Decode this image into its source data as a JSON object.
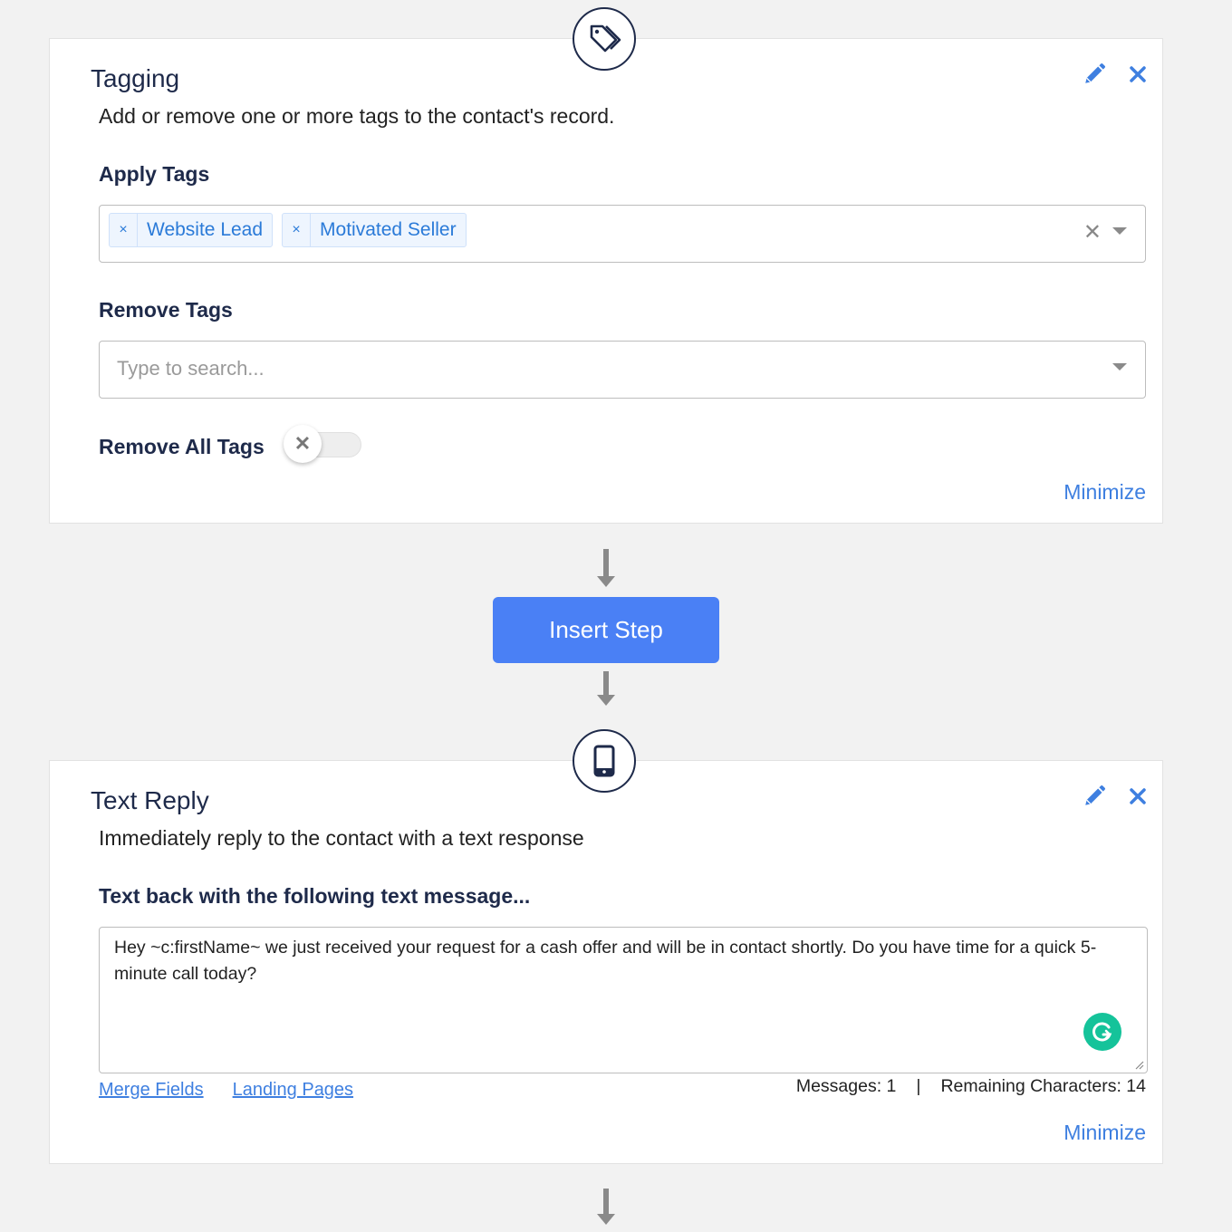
{
  "colors": {
    "background": "#f2f2f2",
    "card": "#ffffff",
    "heading": "#1e2a4a",
    "accent": "#4a80f5",
    "link": "#3e7fe0",
    "tag_bg": "#eef5fe",
    "tag_text": "#2a7ad8",
    "grammarly": "#15c39a"
  },
  "steps": [
    {
      "icon": "tags-icon",
      "title": "Tagging",
      "description": "Add or remove one or more tags to the contact's record.",
      "apply_tags": {
        "label": "Apply Tags",
        "selected": [
          "Website Lead",
          "Motivated Seller"
        ],
        "remove_tag_glyph": "×",
        "clear_glyph": "✕"
      },
      "remove_tags": {
        "label": "Remove Tags",
        "placeholder": "Type to search..."
      },
      "remove_all_tags": {
        "label": "Remove All Tags",
        "enabled": false,
        "knob_glyph": "✕"
      },
      "minimize_label": "Minimize"
    },
    {
      "icon": "mobile-phone-icon",
      "title": "Text Reply",
      "description": "Immediately reply to the contact with a text response",
      "message_label": "Text back with the following text message...",
      "message": "Hey ~c:firstName~ we just received your request for a cash offer and will be in contact shortly. Do you have time for a quick 5-minute call today?",
      "links": [
        "Merge Fields",
        "Landing Pages"
      ],
      "messages_count": "Messages: 1",
      "separator": "|",
      "remaining_characters": "Remaining Characters: 14",
      "minimize_label": "Minimize"
    }
  ],
  "insert_step_label": "Insert Step"
}
